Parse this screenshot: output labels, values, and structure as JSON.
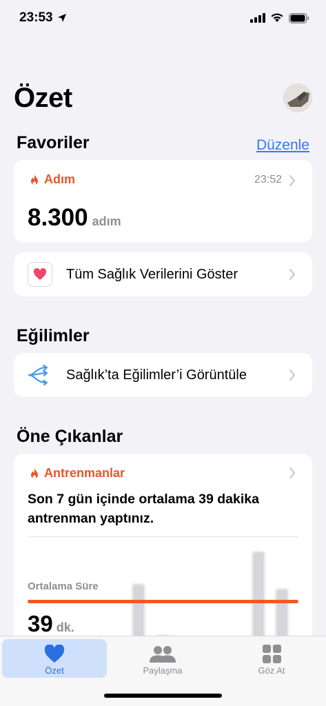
{
  "status": {
    "time": "23:53"
  },
  "header": {
    "title": "Özet"
  },
  "favorites": {
    "section_title": "Favoriler",
    "edit_label": "Düzenle",
    "steps_card": {
      "title": "Adım",
      "time": "23:52",
      "value": "8.300",
      "unit": "adım"
    },
    "all_data_label": "Tüm Sağlık Verilerini Göster"
  },
  "trends": {
    "section_title": "Eğilimler",
    "view_label": "Sağlık’ta Eğilimler’i Görüntüle"
  },
  "highlights": {
    "section_title": "Öne Çıkanlar",
    "workout_card": {
      "title": "Antrenmanlar",
      "summary": "Son 7 gün içinde ortalama 39 dakika antrenman yaptınız.",
      "avg_label": "Ortalama Süre",
      "avg_value": "39",
      "avg_unit": "dk."
    }
  },
  "tabbar": {
    "tabs": [
      {
        "label": "Özet",
        "icon": "heart-icon",
        "active": true
      },
      {
        "label": "Paylaşma",
        "icon": "people-icon",
        "active": false
      },
      {
        "label": "Göz At",
        "icon": "grid-icon",
        "active": false
      }
    ]
  },
  "colors": {
    "accent_orange": "#e8572a",
    "link_blue": "#3478f6",
    "tab_active": "#2a6fe0"
  }
}
